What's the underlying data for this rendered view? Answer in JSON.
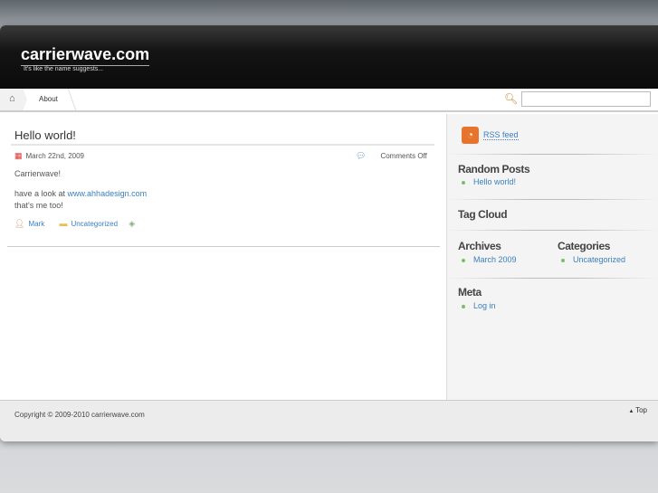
{
  "site": {
    "title": "carrierwave.com",
    "tagline": "It's like the name suggests..."
  },
  "nav": {
    "items": [
      {
        "label": "About"
      }
    ],
    "search_placeholder": ""
  },
  "post": {
    "title": "Hello world!",
    "date": "March 22nd, 2009",
    "comments": "Comments Off",
    "body": [
      "Carrierwave!",
      "have a look at ",
      "www.ahhadesign.com",
      "that's me too!"
    ],
    "author": "Mark",
    "category": "Uncategorized"
  },
  "sidebar": {
    "rss": "RSS feed",
    "random_posts": {
      "title": "Random Posts",
      "items": [
        "Hello world!"
      ]
    },
    "tag_cloud": {
      "title": "Tag Cloud"
    },
    "archives": {
      "title": "Archives",
      "items": [
        "March 2009"
      ]
    },
    "categories": {
      "title": "Categories",
      "items": [
        "Uncategorized"
      ]
    },
    "meta": {
      "title": "Meta",
      "items": [
        "Log in"
      ]
    }
  },
  "footer": {
    "copyright": "Copyright © 2009-2010 carrierwave.com",
    "top": "Top"
  }
}
